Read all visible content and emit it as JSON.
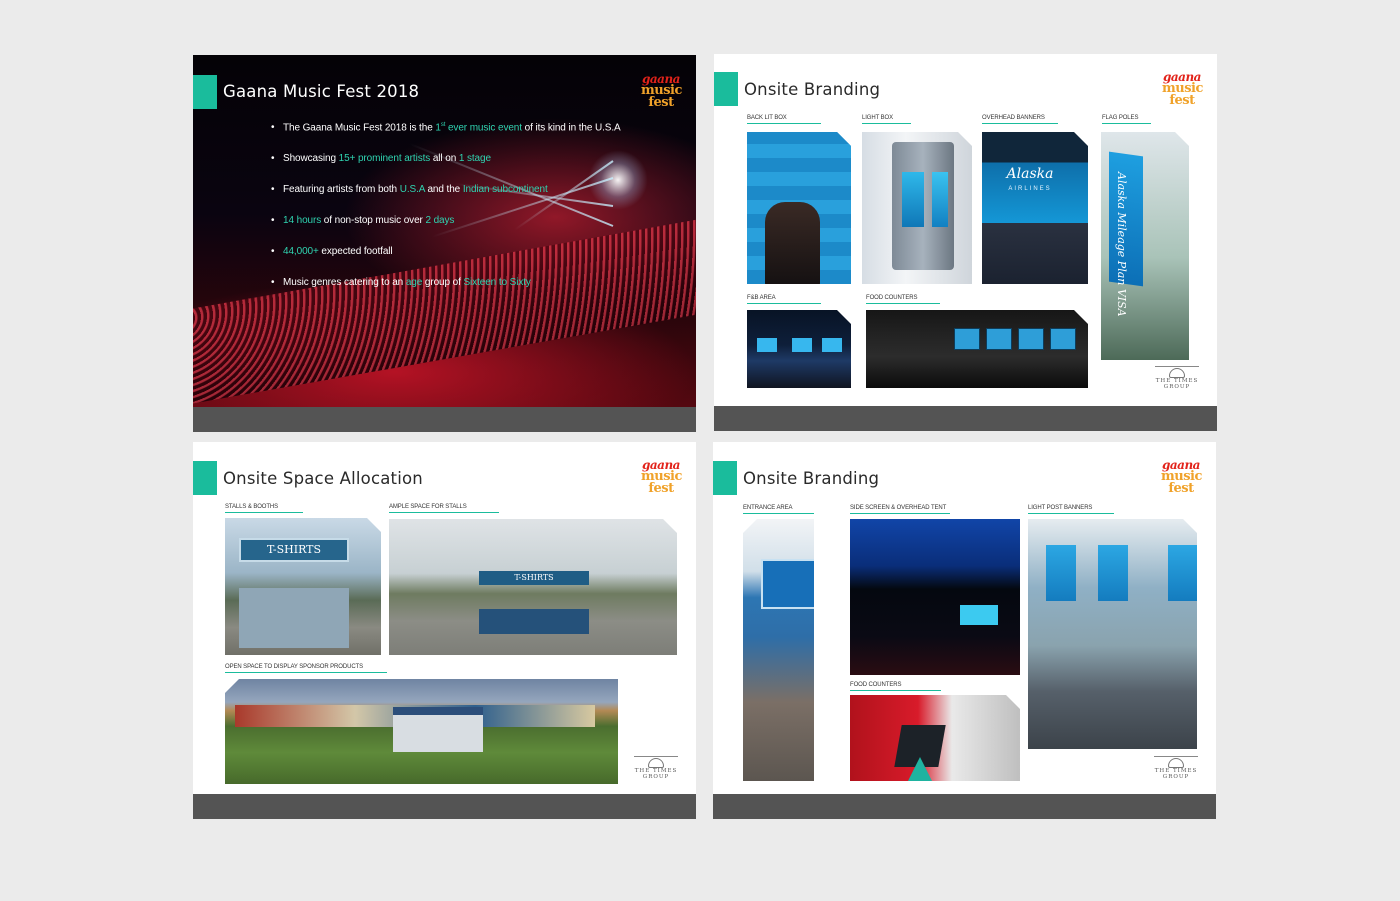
{
  "brand": {
    "logo_line1": "gaana",
    "logo_line2": "music",
    "logo_line3": "fest",
    "times_line1": "THE TIMES",
    "times_line2": "GROUP"
  },
  "colors": {
    "accent": "#1abc9c",
    "highlight": "#2fd3b0",
    "footer": "#545454",
    "background": "#ebebeb"
  },
  "slide1": {
    "title": "Gaana Music Fest 2018",
    "b1": {
      "a": "The Gaana Music Fest 2018  is the ",
      "b": "1",
      "sup": "st",
      "c": " ever music event",
      "d": " of its kind in the U.S.A"
    },
    "b2": {
      "a": "Showcasing ",
      "b": "15+ prominent artists",
      "c": "  all on ",
      "d": "1 stage"
    },
    "b3": {
      "a": "Featuring artists from both ",
      "b": "U.S.A",
      "c": " and the ",
      "d": "Indian subcontinent"
    },
    "b4": {
      "a": "14 hours",
      "b": " of non-stop music over ",
      "c": "2 days"
    },
    "b5": {
      "a": "44,000+",
      "b": " expected footfall"
    },
    "b6": {
      "a": "Music genres catering to an ",
      "b": "age",
      "c": " group of ",
      "d": "Sixteen to Sixty"
    }
  },
  "slide2": {
    "title": "Onsite Branding",
    "labels": {
      "back_lit_box": "BACK LIT BOX",
      "light_box": "LIGHT BOX",
      "overhead_banners": "OVERHEAD BANNERS",
      "flag_poles": "FLAG POLES",
      "fb_area": "F&B AREA",
      "food_counters": "FOOD COUNTERS"
    },
    "photo_text": {
      "alaska": "Alaska",
      "airlines": "AIRLINES",
      "flag": "Alaska Mileage Plan VISA"
    }
  },
  "slide3": {
    "title": "Onsite Space Allocation",
    "labels": {
      "stalls_booths": "STALLS & BOOTHS",
      "ample_space": "AMPLE SPACE FOR STALLS",
      "open_space": "OPEN SPACE TO DISPLAY SPONSOR PRODUCTS"
    },
    "photo_text": {
      "tshirts_big": "T-SHIRTS",
      "tshirts_small": "T-SHIRTS"
    }
  },
  "slide4": {
    "title": "Onsite Branding",
    "labels": {
      "entrance_area": "ENTRANCE AREA",
      "side_screen": "SIDE SCREEN & OVERHEAD TENT",
      "light_post": "LIGHT POST BANNERS",
      "food_counters": "FOOD COUNTERS"
    }
  }
}
